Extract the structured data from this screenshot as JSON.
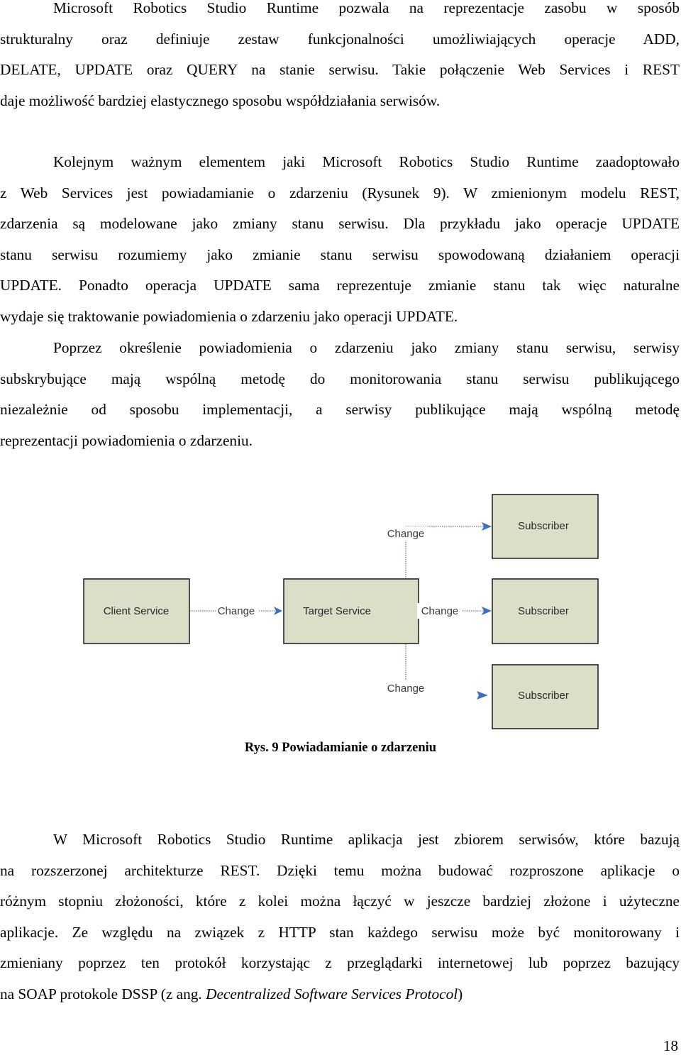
{
  "paragraphs": [
    {
      "id": "p1",
      "lines": [
        "Microsoft Robotics Studio Runtime pozwala na reprezentacje zasobu w sposób",
        "strukturalny oraz definiuje zestaw funkcjonalności umożliwiających operacje ADD,",
        "DELATE, UPDATE oraz QUERY na stanie serwisu. Takie połączenie Web Services i REST",
        "daje możliwość bardziej elastycznego sposobu współdziałania serwisów."
      ]
    },
    {
      "id": "p2",
      "lines": [
        "Kolejnym ważnym elementem jaki Microsoft Robotics Studio Runtime zaadoptowało",
        "z Web Services jest powiadamianie o zdarzeniu (Rysunek 9). W zmienionym modelu REST,",
        "zdarzenia są modelowane jako zmiany stanu serwisu. Dla przykładu jako operacje UPDATE",
        "stanu serwisu rozumiemy jako zmianie stanu serwisu spowodowaną działaniem operacji",
        "UPDATE. Ponadto operacja UPDATE sama reprezentuje zmianie stanu tak więc naturalne",
        "wydaje się traktowanie powiadomienia o zdarzeniu jako operacji UPDATE."
      ]
    },
    {
      "id": "p3",
      "lines": [
        "Poprzez określenie powiadomienia o zdarzeniu jako zmiany stanu serwisu, serwisy",
        "subskrybujące mają wspólną metodę do monitorowania stanu serwisu publikującego",
        "niezależnie od sposobu implementacji, a serwisy publikujące mają wspólną metodę",
        "reprezentacji powiadomienia o zdarzeniu."
      ]
    },
    {
      "id": "p4",
      "lines": [
        "W Microsoft Robotics Studio Runtime aplikacja jest zbiorem serwisów, które bazują",
        "na rozszerzonej architekturze REST. Dzięki temu można budować rozproszone aplikacje o",
        "różnym stopniu złożoności, które z kolei można łączyć w jeszcze bardziej złożone i użyteczne",
        "aplikacje. Ze względu na związek z HTTP stan każdego serwisu może być monitorowany i",
        "zmieniany poprzez ten protokół korzystając z  przeglądarki internetowej lub poprzez bazujący"
      ],
      "last_line_prefix": "na SOAP protokole DSSP (z ang. ",
      "last_line_italic": "Decentralized Software Services Protocol",
      "last_line_suffix": ")"
    }
  ],
  "figure": {
    "caption": "Rys. 9 Powiadamianie o zdarzeniu",
    "nodes": {
      "client": "Client Service",
      "target": "Target Service",
      "subscriber_top": "Subscriber",
      "subscriber_middle": "Subscriber",
      "subscriber_bottom": "Subscriber"
    },
    "edges": {
      "client_to_target": "Change",
      "target_to_top": "Change",
      "target_to_middle": "Change",
      "target_to_bottom": "Change"
    },
    "colors": {
      "box_fill": "#dcdec8",
      "box_border": "#1a1a1a",
      "arrow": "#3b6fc4",
      "connector": "#5a7aa8"
    }
  },
  "page_number": "18"
}
